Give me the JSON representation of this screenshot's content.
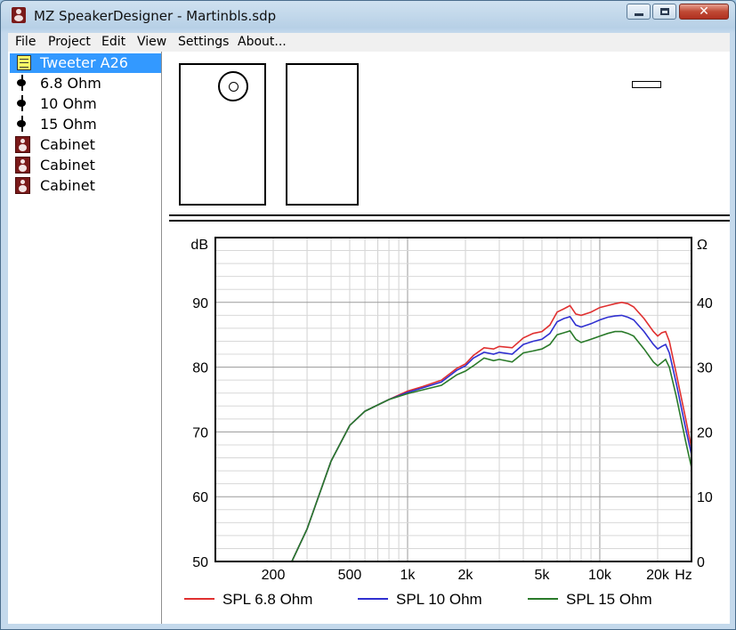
{
  "window": {
    "title": "MZ SpeakerDesigner - Martinbls.sdp",
    "close_glyph": "✕"
  },
  "menu": [
    "File",
    "Project",
    "Edit",
    "View",
    "Settings",
    "About..."
  ],
  "tree": [
    {
      "label": "Tweeter A26",
      "icon": "note-icon",
      "selected": true
    },
    {
      "label": "6.8 Ohm",
      "icon": "resistor-icon"
    },
    {
      "label": "10 Ohm",
      "icon": "resistor-icon"
    },
    {
      "label": "15 Ohm",
      "icon": "resistor-icon"
    },
    {
      "label": "Cabinet",
      "icon": "cabinet-icon"
    },
    {
      "label": "Cabinet",
      "icon": "cabinet-icon"
    },
    {
      "label": "Cabinet",
      "icon": "cabinet-icon"
    }
  ],
  "chart_data": {
    "type": "line",
    "ylabel": "dB",
    "y2label": "Ω",
    "xunit": "Hz",
    "xscale": "log",
    "xlim": [
      100,
      30000
    ],
    "ylim": [
      50,
      100
    ],
    "y2lim": [
      0,
      50
    ],
    "x_tick_labels": [
      "200",
      "500",
      "1k",
      "2k",
      "5k",
      "10k",
      "20k"
    ],
    "x_tick_values": [
      200,
      500,
      1000,
      2000,
      5000,
      10000,
      20000
    ],
    "y_ticks": [
      50,
      60,
      70,
      80,
      90
    ],
    "y2_ticks": [
      0,
      10,
      20,
      30,
      40
    ],
    "grid": true,
    "legend_position": "bottom",
    "x": [
      250,
      300,
      400,
      500,
      600,
      800,
      1000,
      1200,
      1500,
      1800,
      2000,
      2200,
      2500,
      2800,
      3000,
      3500,
      4000,
      4500,
      5000,
      5500,
      6000,
      6500,
      7000,
      7500,
      8000,
      9000,
      10000,
      11000,
      12000,
      13000,
      14000,
      15000,
      17000,
      19000,
      20000,
      21000,
      22000,
      23000,
      25000,
      28000,
      30000
    ],
    "series": [
      {
        "name": "SPL 6.8 Ohm",
        "color": "#e03030",
        "values": [
          45,
          55,
          65.5,
          71,
          73.2,
          75,
          76.3,
          77,
          78,
          79.8,
          80.5,
          81.8,
          83,
          82.8,
          83.2,
          83,
          84.5,
          85.2,
          85.5,
          86.5,
          88.5,
          89,
          89.5,
          88.2,
          88,
          88.5,
          89.2,
          89.5,
          89.8,
          90,
          89.8,
          89.3,
          87.5,
          85.5,
          84.8,
          85.3,
          85.5,
          84,
          79,
          72,
          67.5
        ]
      },
      {
        "name": "SPL 10 Ohm",
        "color": "#3030d0",
        "values": [
          45,
          55,
          65.5,
          71,
          73.2,
          75,
          76.1,
          76.8,
          77.7,
          79.5,
          80.2,
          81.4,
          82.3,
          82,
          82.3,
          82,
          83.5,
          84,
          84.3,
          85.2,
          87,
          87.5,
          87.8,
          86.5,
          86.2,
          86.7,
          87.3,
          87.7,
          87.9,
          88,
          87.7,
          87.3,
          85.5,
          83.5,
          82.8,
          83.2,
          83.5,
          82.2,
          77.5,
          70.5,
          66.5
        ]
      },
      {
        "name": "SPL 15 Ohm",
        "color": "#2a7a2a",
        "values": [
          45,
          55,
          65.5,
          71,
          73.2,
          75,
          75.9,
          76.5,
          77.2,
          78.8,
          79.4,
          80.2,
          81.4,
          81,
          81.2,
          80.8,
          82.2,
          82.5,
          82.8,
          83.5,
          85,
          85.3,
          85.6,
          84.3,
          83.8,
          84.3,
          84.8,
          85.2,
          85.5,
          85.5,
          85.2,
          84.8,
          82.8,
          80.8,
          80.2,
          80.7,
          81.2,
          80,
          75.5,
          68.5,
          64.5
        ]
      }
    ]
  }
}
